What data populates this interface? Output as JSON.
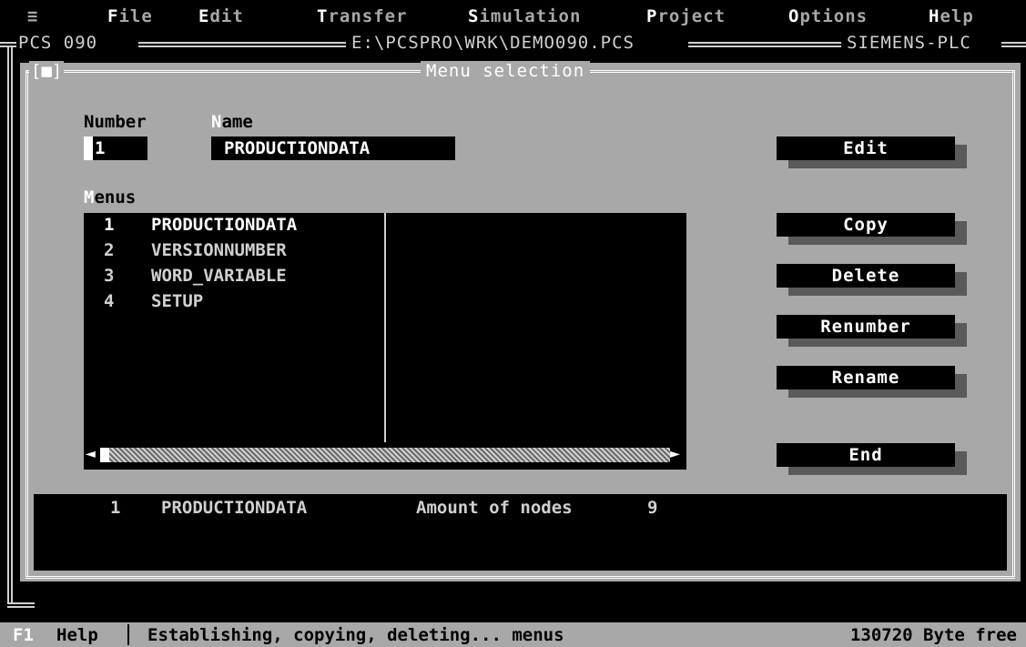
{
  "menubar": {
    "system_icon": "≡",
    "items": [
      {
        "hotkey": "F",
        "rest": "ile"
      },
      {
        "hotkey": "E",
        "rest": "dit"
      },
      {
        "hotkey": "T",
        "rest": "ransfer"
      },
      {
        "hotkey": "S",
        "rest": "imulation"
      },
      {
        "hotkey": "P",
        "rest": "roject"
      },
      {
        "hotkey": "O",
        "rest": "ptions"
      },
      {
        "hotkey": "H",
        "rest": "elp"
      }
    ]
  },
  "window": {
    "program": "PCS 090",
    "path": "E:\\PCSPRO\\WRK\\DEMO090.PCS",
    "plc": "SIEMENS-PLC"
  },
  "dialog": {
    "title": "Menu selection",
    "close_box": "[■]",
    "number_label": {
      "hotkey": "",
      "text": "Number"
    },
    "name_label": {
      "hotkey": "N",
      "rest": "ame"
    },
    "number_value": "1",
    "name_value": "PRODUCTIONDATA",
    "menus_label": {
      "hotkey": "M",
      "rest": "enus"
    },
    "menus": [
      {
        "number": "1",
        "name": "PRODUCTIONDATA",
        "selected": true
      },
      {
        "number": "2",
        "name": "VERSIONNUMBER",
        "selected": false
      },
      {
        "number": "3",
        "name": "WORD_VARIABLE",
        "selected": false
      },
      {
        "number": "4",
        "name": "SETUP",
        "selected": false
      }
    ],
    "buttons": {
      "edit": "Edit",
      "copy": "Copy",
      "delete": "Delete",
      "renumber": "Renumber",
      "rename": "Rename",
      "end": "End"
    },
    "info": {
      "number": "1",
      "name": "PRODUCTIONDATA",
      "nodes_label": "Amount of nodes",
      "nodes_value": "9"
    }
  },
  "statusbar": {
    "key": "F1",
    "help": "Help",
    "message": "Establishing, copying, deleting... menus",
    "free": "130720 Byte free"
  }
}
